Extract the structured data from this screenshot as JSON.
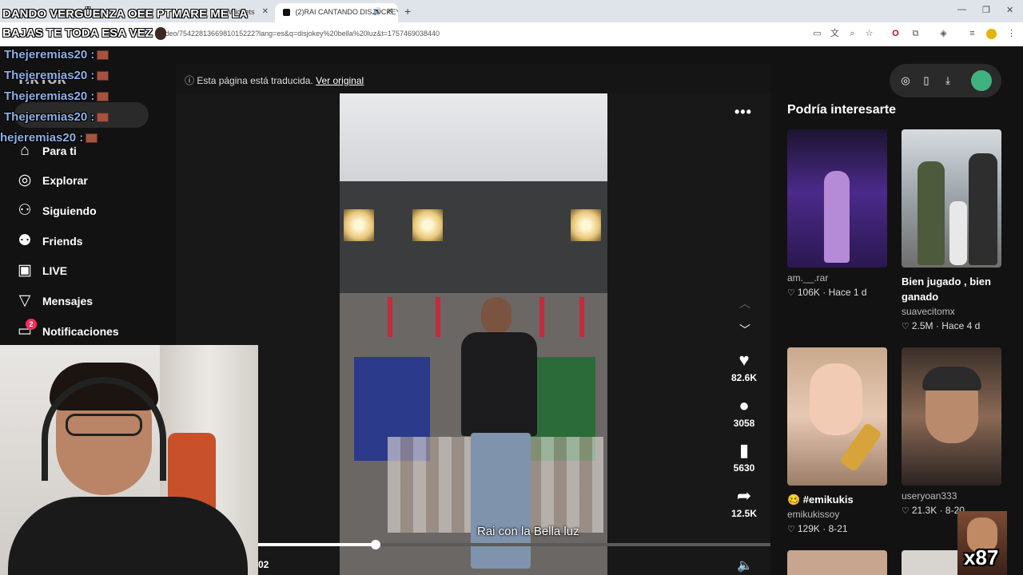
{
  "browser": {
    "tabs": [
      {
        "label": "Widgets"
      },
      {
        "label": "(2)RAI CANTANDO DISJOCKEY"
      }
    ],
    "url": "video/7542281366981015222?lang=es&q=disjokey%20bella%20luz&t=1757469038440"
  },
  "stream_overlay": {
    "top_line_1": "DANDO VERGÜENZA OEE PTMARE ME LA",
    "top_line_2": "BAJAS TE TODA ESA VEZ",
    "chat": [
      {
        "user": "Thejeremias20 :"
      },
      {
        "user": "Thejeremias20 :"
      },
      {
        "user": "Thejeremias20 :"
      },
      {
        "user": "Thejeremias20 :"
      },
      {
        "user": "hejeremias20 :"
      }
    ],
    "meme_counter": "x87"
  },
  "sidebar": {
    "logo": "TikTok",
    "items": [
      {
        "label": "Para ti",
        "icon": "home-icon"
      },
      {
        "label": "Explorar",
        "icon": "compass-icon"
      },
      {
        "label": "Siguiendo",
        "icon": "user-follow-icon"
      },
      {
        "label": "Friends",
        "icon": "friends-icon"
      },
      {
        "label": "LIVE",
        "icon": "live-icon"
      },
      {
        "label": "Mensajes",
        "icon": "message-icon"
      },
      {
        "label": "Notificaciones",
        "icon": "notification-icon",
        "badge": "2"
      }
    ]
  },
  "player": {
    "translated_notice": "Esta página está traducida.",
    "view_original": "Ver original",
    "caption": "Rai con la Bella luz",
    "time": "02",
    "progress": 0.23,
    "likes": "82.6K",
    "comments": "3058",
    "saves": "5630",
    "shares": "12.5K"
  },
  "recommendations": {
    "title": "Podría interesarte",
    "items": [
      {
        "title": "",
        "user": "am.__.rar",
        "likes": "106K",
        "time": "Hace 1 d"
      },
      {
        "title": "Bien jugado , bien ganado",
        "user": "suavecitomx",
        "likes": "2.5M",
        "time": "Hace 4 d"
      },
      {
        "title": "🥴 #emikukis",
        "user": "emikukissoy",
        "likes": "129K",
        "time": "8-21"
      },
      {
        "title": "",
        "user": "useryoan333",
        "likes": "21.3K",
        "time": "8-20"
      }
    ]
  },
  "colors": {
    "accent": "#fe2c55",
    "background": "#121212",
    "chat_name": "#8fb0e8"
  }
}
